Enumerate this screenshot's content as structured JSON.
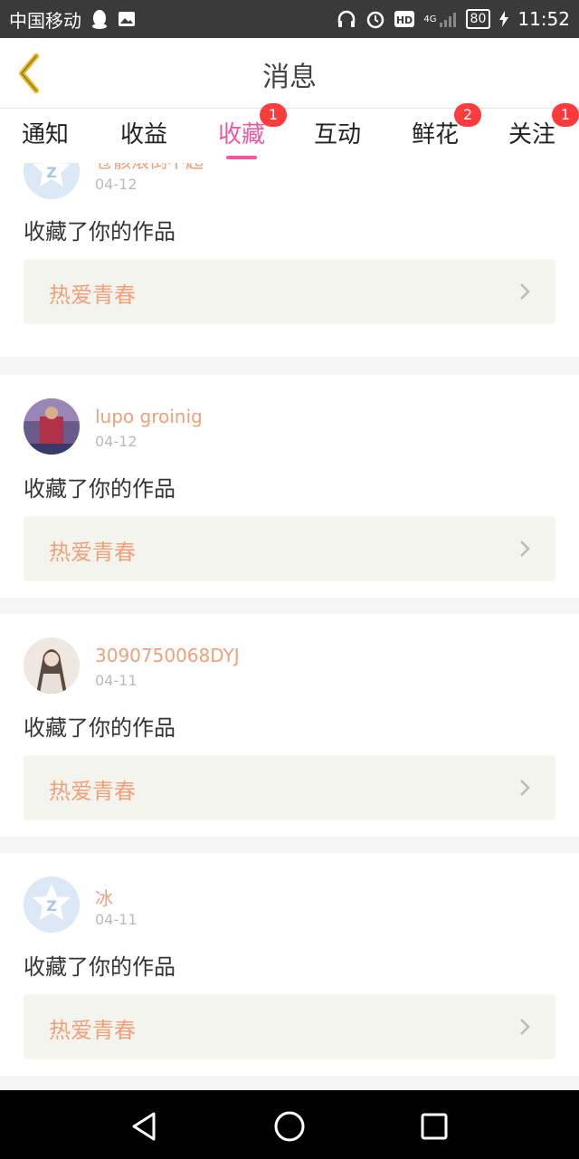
{
  "status_bar": {
    "carrier": "中国移动",
    "network": "4G",
    "battery": "80",
    "time": "11:52"
  },
  "header": {
    "title": "消息"
  },
  "tabs": [
    {
      "label": "通知",
      "badge": ""
    },
    {
      "label": "收益",
      "badge": ""
    },
    {
      "label": "收藏",
      "badge": "1",
      "active": true
    },
    {
      "label": "互动",
      "badge": ""
    },
    {
      "label": "鲜花",
      "badge": "2"
    },
    {
      "label": "关注",
      "badge": "1"
    }
  ],
  "messages": [
    {
      "user": "苍骸滚倒不起",
      "date": "04-12",
      "action": "收藏了你的作品",
      "work": "热爱青春",
      "avatar": "default-avatar-icon"
    },
    {
      "user": "lupo groinig",
      "date": "04-12",
      "action": "收藏了你的作品",
      "work": "热爱青春",
      "avatar": "user-photo"
    },
    {
      "user": "3090750068DYJ",
      "date": "04-11",
      "action": "收藏了你的作品",
      "work": "热爱青春",
      "avatar": "user-photo"
    },
    {
      "user": "冰",
      "date": "04-11",
      "action": "收藏了你的作品",
      "work": "热爱青春",
      "avatar": "default-avatar-icon"
    }
  ],
  "colors": {
    "accent": "#ee5aa0",
    "username": "#f0a07a",
    "badge": "#ff3b3b",
    "back_icon": "#e6b820"
  }
}
